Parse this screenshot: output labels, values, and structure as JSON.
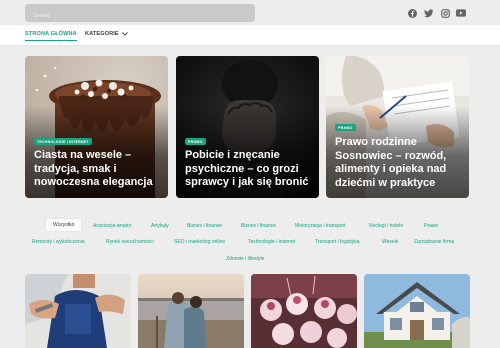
{
  "search": {
    "placeholder": "Szukaj"
  },
  "social": [
    {
      "name": "facebook-icon",
      "color": "#666666"
    },
    {
      "name": "twitter-icon",
      "color": "#666666"
    },
    {
      "name": "instagram-icon",
      "color": "#666666"
    },
    {
      "name": "youtube-icon",
      "color": "#666666"
    }
  ],
  "nav": {
    "home_label": "STRONA GŁÓWNA",
    "categories_label": "KATEGORIE"
  },
  "featured": [
    {
      "badge": "TECHNOLOGIE I INTERNET",
      "title": "Ciasta na wesele – tradycja, smak i nowoczesna elegancja"
    },
    {
      "badge": "PRAWO",
      "title": "Pobicie i znęcanie psychiczne – co grozi sprawcy i jak się bronić"
    },
    {
      "badge": "PRAWO",
      "title": "Prawo rodzinne Sosnowiec – rozwód, alimenty i opieka nad dziećmi w praktyce"
    }
  ],
  "tabs": {
    "row1": [
      "Wszystko",
      "Aranżacja wnętrz",
      "Artykuły",
      "Biznes i finanse",
      "Biznes i finance",
      "Motoryzacja i transport",
      "Noclegi i hotele",
      "Prawo"
    ],
    "row2": [
      "Remonty i wykończenia",
      "Rynek nieruchomości",
      "SEO i marketing online",
      "Technologie i internet",
      "Transport i logistyka",
      "Wesele",
      "Zarządzanie firmą"
    ],
    "row3": [
      "Zdrowie i lifestyle"
    ]
  },
  "colors": {
    "accent": "#1aa37f",
    "background": "#ededed"
  }
}
